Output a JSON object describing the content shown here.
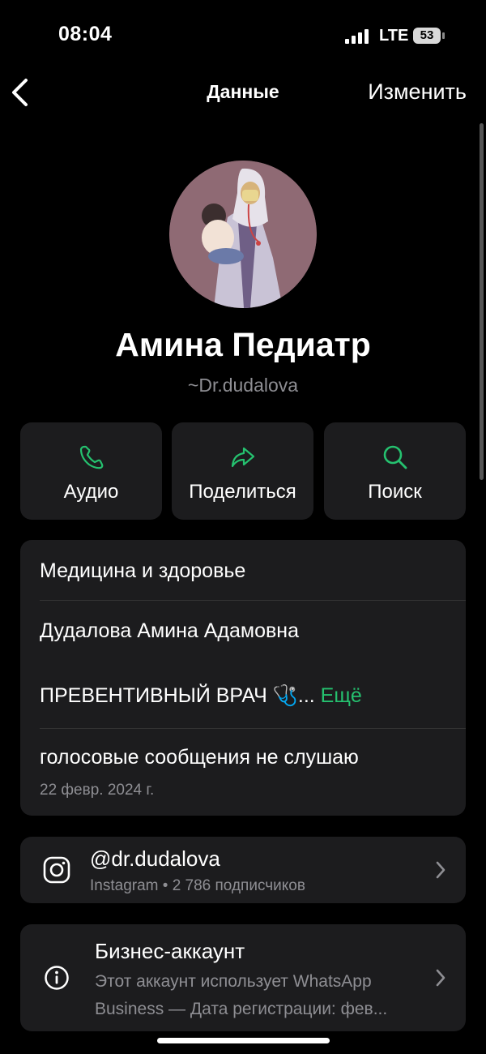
{
  "status_bar": {
    "time": "08:04",
    "network": "LTE",
    "battery": "53"
  },
  "nav": {
    "title": "Данные",
    "edit_label": "Изменить"
  },
  "profile": {
    "name": "Амина Педиатр",
    "username": "~Dr.dudalova"
  },
  "actions": [
    {
      "label": "Аудио",
      "icon": "phone-icon"
    },
    {
      "label": "Поделиться",
      "icon": "share-icon"
    },
    {
      "label": "Поиск",
      "icon": "search-icon"
    }
  ],
  "info": {
    "category": "Медицина и здоровье",
    "full_name": "Дудалова Амина Адамовна",
    "bio_truncated": "ПРЕВЕНТИВНЫЙ ВРАЧ 🩺...",
    "more_label": "Ещё",
    "status": "голосовые сообщения не слушаю",
    "status_date": "22 февр. 2024 г."
  },
  "instagram": {
    "handle": "@dr.dudalova",
    "subtitle": "Instagram • 2 786 подписчиков"
  },
  "business": {
    "title": "Бизнес-аккаунт",
    "line1": "Этот аккаунт использует WhatsApp",
    "line2": "Business — Дата регистрации: фев..."
  },
  "colors": {
    "accent": "#25c16f",
    "card": "#1c1c1e",
    "secondary_text": "#8e8e93"
  }
}
